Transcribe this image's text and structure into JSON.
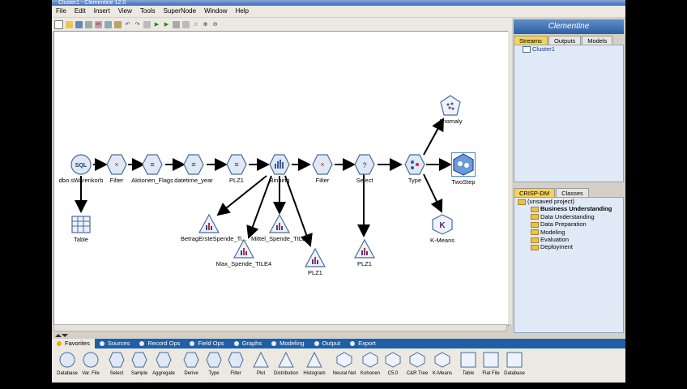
{
  "window": {
    "title": "Cluster1 - Clementine 12.0"
  },
  "menu": [
    "File",
    "Edit",
    "Insert",
    "View",
    "Tools",
    "SuperNode",
    "Window",
    "Help"
  ],
  "logo": "Clementine",
  "top_tabs": [
    "Streams",
    "Outputs",
    "Models"
  ],
  "streams": [
    "Cluster1"
  ],
  "bottom_tabs": [
    "CRISP-DM",
    "Classes"
  ],
  "crisp": {
    "root": "(unsaved project)",
    "items": [
      "Business Understanding",
      "Data Understanding",
      "Data Preparation",
      "Modeling",
      "Evaluation",
      "Deployment"
    ]
  },
  "nodes": {
    "db": "dbo.sWarenkorb",
    "filter1": "Filter",
    "aktionen": "Aktionen_Flags",
    "datetime": "datetime_year",
    "plz1": "PLZ1",
    "binning": "Binning",
    "filter2": "Filter",
    "select": "Select",
    "type": "Type",
    "twostep": "TwoStep",
    "anomaly": "Anomaly",
    "table": "Table",
    "kmeans": "K-Means",
    "betrag": "BetragErsteSpende_Ti...",
    "mittel": "Mittel_Spende_TILE4",
    "max": "Max_Spende_TILE4",
    "plz1b": "PLZ1",
    "plz1c": "PLZ1"
  },
  "palette_tabs": [
    "Favorites",
    "Sources",
    "Record Ops",
    "Field Ops",
    "Graphs",
    "Modeling",
    "Output",
    "Export"
  ],
  "palette_items": [
    "Database",
    "Var. File",
    "Select",
    "Sample",
    "Aggregate",
    "Derive",
    "Type",
    "Filter",
    "Plot",
    "Distribution",
    "Histogram",
    "Neural Net",
    "Kohonen",
    "C5.0",
    "C&R Tree",
    "K-Means",
    "Table",
    "Flat File",
    "Database"
  ],
  "colors": {
    "accent": "#1f5fa8",
    "active_tab": "#f3d35a",
    "panel": "#e0eaf6"
  }
}
